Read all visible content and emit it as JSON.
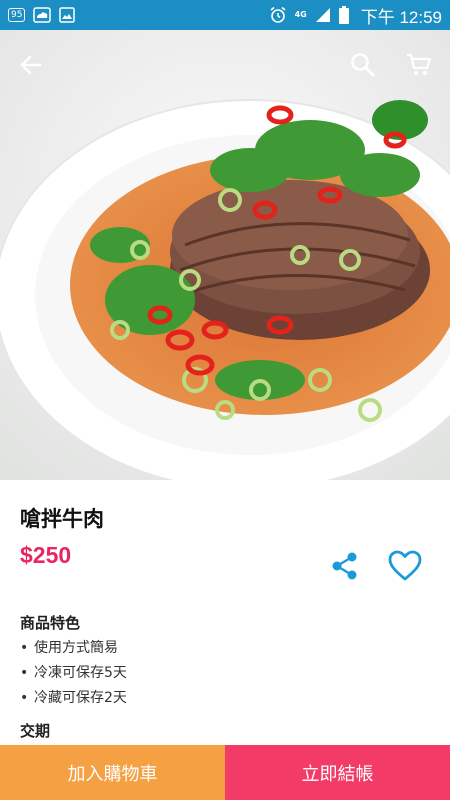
{
  "status_bar": {
    "badge": "95",
    "network": "4G",
    "time": "下午 12:59"
  },
  "toolbar": {
    "back_icon": "arrow-left-icon",
    "search_icon": "search-icon",
    "cart_icon": "cart-icon"
  },
  "product": {
    "image": "spicy-beef-dish",
    "name": "嗆拌牛肉",
    "price": "$250"
  },
  "actions": {
    "share_icon": "share-icon",
    "favorite_icon": "heart-icon"
  },
  "features": {
    "title": "商品特色",
    "items": [
      "使用方式簡易",
      "冷凍可保存5天",
      "冷藏可保存2天"
    ]
  },
  "delivery": {
    "title": "交期"
  },
  "bottom_bar": {
    "add_to_cart": "加入購物車",
    "checkout": "立即結帳"
  },
  "colors": {
    "status_bar": "#1b8fc4",
    "price": "#e8275f",
    "accent_icon": "#1a9ad6",
    "add_to_cart_bg": "#f5a043",
    "checkout_bg": "#f23b67"
  }
}
